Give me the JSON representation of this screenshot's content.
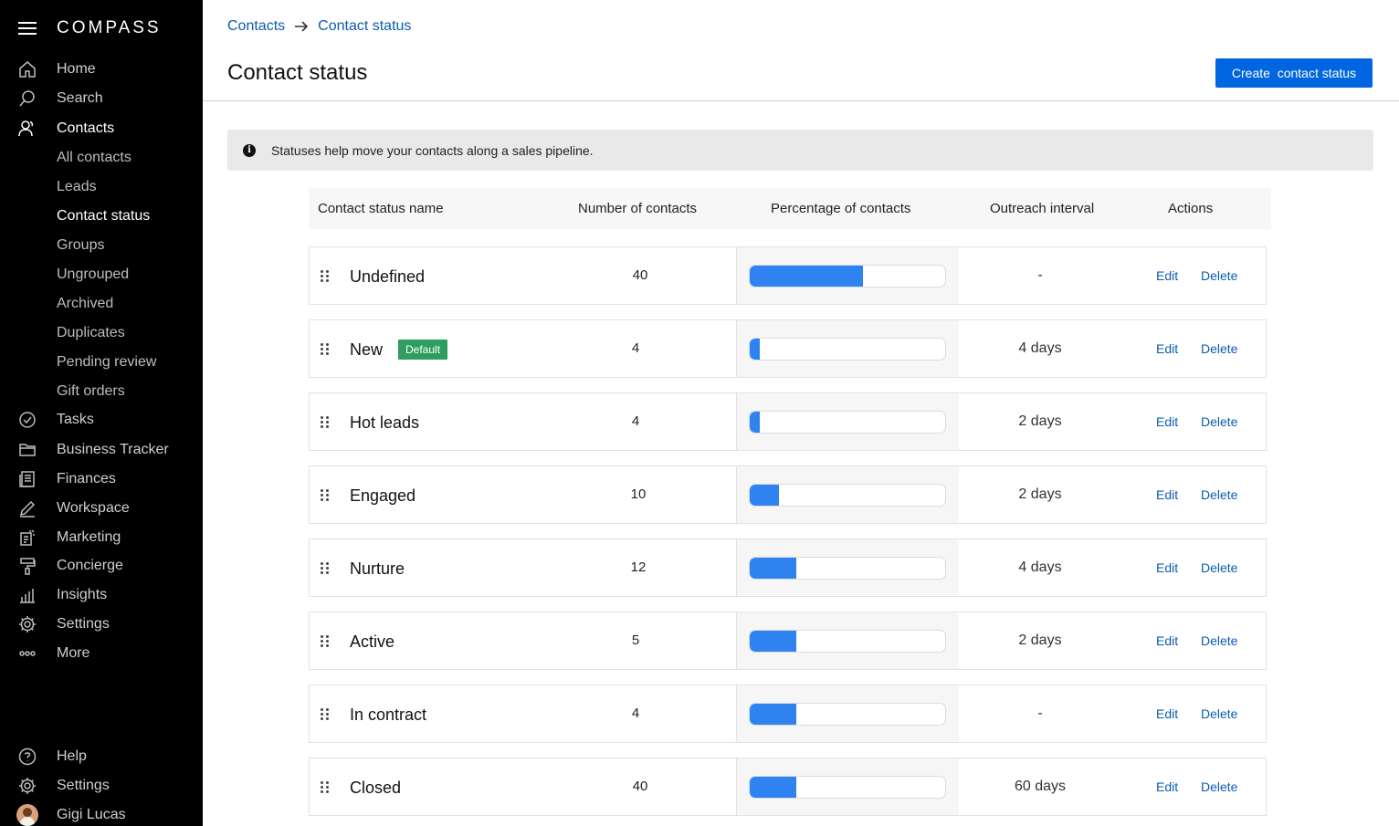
{
  "app": {
    "logo": "COMPASS"
  },
  "sidebar": {
    "nav": [
      {
        "label": "Home",
        "icon": "home-icon"
      },
      {
        "label": "Search",
        "icon": "search-icon"
      },
      {
        "label": "Contacts",
        "icon": "contacts-icon"
      }
    ],
    "sub_items": [
      "All contacts",
      "Leads",
      "Contact status",
      "Groups",
      "Ungrouped",
      "Archived",
      "Duplicates",
      "Pending review",
      "Gift orders"
    ],
    "nav2": [
      {
        "label": "Tasks",
        "icon": "tasks-icon"
      },
      {
        "label": "Business Tracker",
        "icon": "folder-icon"
      },
      {
        "label": "Finances",
        "icon": "finances-icon"
      },
      {
        "label": "Workspace",
        "icon": "pencil-icon"
      },
      {
        "label": "Marketing",
        "icon": "marketing-icon"
      },
      {
        "label": "Concierge",
        "icon": "paint-roller-icon"
      },
      {
        "label": "Insights",
        "icon": "bar-chart-icon"
      },
      {
        "label": "Settings",
        "icon": "gear-icon"
      },
      {
        "label": "More",
        "icon": "more-icon"
      }
    ],
    "footer": [
      {
        "label": "Help",
        "icon": "help-icon"
      },
      {
        "label": "Settings",
        "icon": "gear-icon"
      },
      {
        "label": "Gigi Lucas",
        "icon": "avatar"
      }
    ]
  },
  "breadcrumb": {
    "parent": "Contacts",
    "current": "Contact status"
  },
  "page": {
    "title": "Contact status",
    "create_button": "Create  contact status"
  },
  "info": {
    "text": "Statuses help move your contacts along a sales pipeline."
  },
  "table": {
    "headers": {
      "name": "Contact status name",
      "count": "Number of contacts",
      "percentage": "Percentage of contacts",
      "interval": "Outreach interval",
      "actions": "Actions"
    },
    "edit_label": "Edit",
    "delete_label": "Delete",
    "rows": [
      {
        "name": "Undefined",
        "badge": "",
        "count": "40",
        "percent": 58,
        "interval": "-"
      },
      {
        "name": "New",
        "badge": "Default",
        "count": "4",
        "percent": 5,
        "interval": "4 days"
      },
      {
        "name": "Hot leads",
        "badge": "",
        "count": "4",
        "percent": 5,
        "interval": "2 days"
      },
      {
        "name": "Engaged",
        "badge": "",
        "count": "10",
        "percent": 15,
        "interval": "2 days"
      },
      {
        "name": "Nurture",
        "badge": "",
        "count": "12",
        "percent": 24,
        "interval": "4 days"
      },
      {
        "name": "Active",
        "badge": "",
        "count": "5",
        "percent": 24,
        "interval": "2 days"
      },
      {
        "name": "In contract",
        "badge": "",
        "count": "4",
        "percent": 24,
        "interval": "-"
      },
      {
        "name": "Closed",
        "badge": "",
        "count": "40",
        "percent": 24,
        "interval": "60 days"
      }
    ]
  },
  "colors": {
    "accent": "#0066e0",
    "link": "#0b5cad",
    "bar": "#2f83f0",
    "badge": "#2e9e5e",
    "sidebar_bg": "#000000"
  }
}
